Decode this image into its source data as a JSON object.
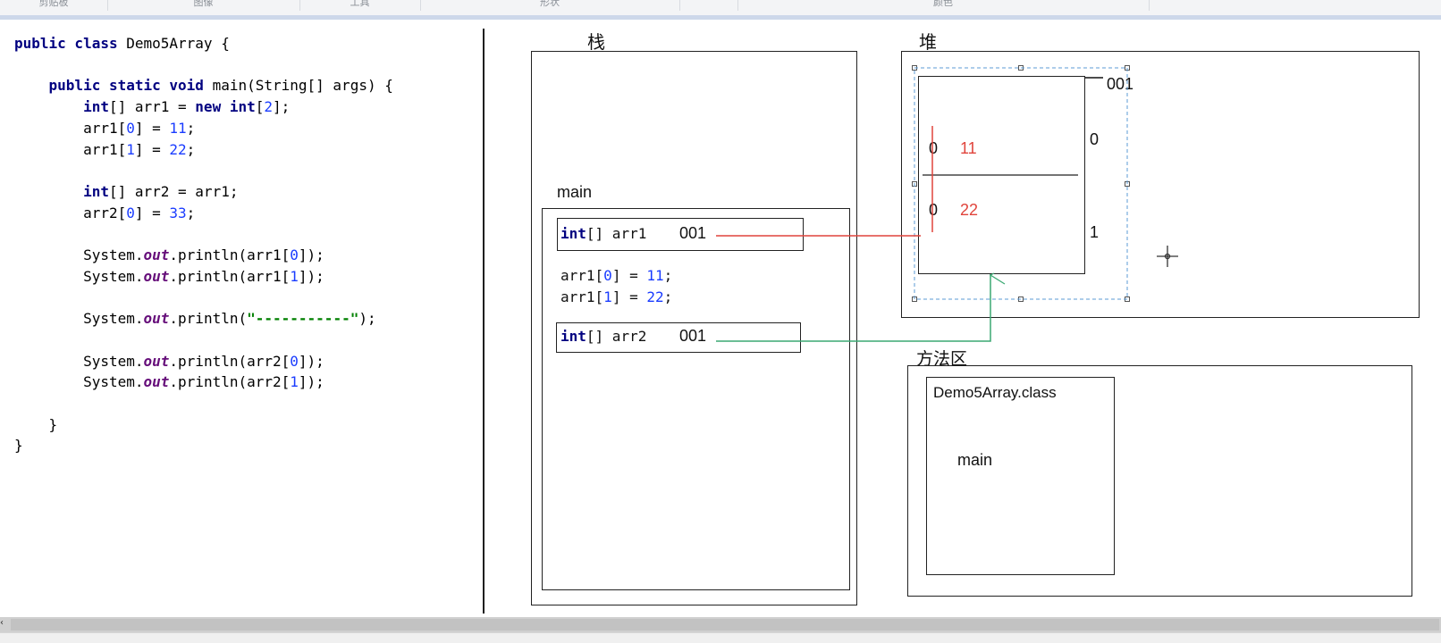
{
  "ribbon": {
    "groups": [
      "剪贴板",
      "图像",
      "工具",
      "形状",
      "颜色"
    ]
  },
  "code": {
    "lines": [
      [
        {
          "t": "public class ",
          "c": "kw"
        },
        {
          "t": "Demo5Array {",
          "c": ""
        }
      ],
      [],
      [
        {
          "t": "    public static void ",
          "c": "kw"
        },
        {
          "t": "main(String[] args) {",
          "c": ""
        }
      ],
      [
        {
          "t": "        int",
          "c": "kw"
        },
        {
          "t": "[] arr1 = ",
          "c": ""
        },
        {
          "t": "new int",
          "c": "kw"
        },
        {
          "t": "[",
          "c": ""
        },
        {
          "t": "2",
          "c": "num"
        },
        {
          "t": "];",
          "c": ""
        }
      ],
      [
        {
          "t": "        arr1[",
          "c": ""
        },
        {
          "t": "0",
          "c": "num"
        },
        {
          "t": "] = ",
          "c": ""
        },
        {
          "t": "11",
          "c": "num"
        },
        {
          "t": ";",
          "c": ""
        }
      ],
      [
        {
          "t": "        arr1[",
          "c": ""
        },
        {
          "t": "1",
          "c": "num"
        },
        {
          "t": "] = ",
          "c": ""
        },
        {
          "t": "22",
          "c": "num"
        },
        {
          "t": ";",
          "c": ""
        }
      ],
      [],
      [
        {
          "t": "        int",
          "c": "kw"
        },
        {
          "t": "[] arr2 = arr1;",
          "c": ""
        }
      ],
      [
        {
          "t": "        arr2[",
          "c": ""
        },
        {
          "t": "0",
          "c": "num"
        },
        {
          "t": "] = ",
          "c": ""
        },
        {
          "t": "33",
          "c": "num"
        },
        {
          "t": ";",
          "c": ""
        }
      ],
      [],
      [
        {
          "t": "        System.",
          "c": ""
        },
        {
          "t": "out",
          "c": "fld"
        },
        {
          "t": ".println(arr1[",
          "c": ""
        },
        {
          "t": "0",
          "c": "num"
        },
        {
          "t": "]);",
          "c": ""
        }
      ],
      [
        {
          "t": "        System.",
          "c": ""
        },
        {
          "t": "out",
          "c": "fld"
        },
        {
          "t": ".println(arr1[",
          "c": ""
        },
        {
          "t": "1",
          "c": "num"
        },
        {
          "t": "]);",
          "c": ""
        }
      ],
      [],
      [
        {
          "t": "        System.",
          "c": ""
        },
        {
          "t": "out",
          "c": "fld"
        },
        {
          "t": ".println(",
          "c": ""
        },
        {
          "t": "\"-----------\"",
          "c": "str"
        },
        {
          "t": ");",
          "c": ""
        }
      ],
      [],
      [
        {
          "t": "        System.",
          "c": ""
        },
        {
          "t": "out",
          "c": "fld"
        },
        {
          "t": ".println(arr2[",
          "c": ""
        },
        {
          "t": "0",
          "c": "num"
        },
        {
          "t": "]);",
          "c": ""
        }
      ],
      [
        {
          "t": "        System.",
          "c": ""
        },
        {
          "t": "out",
          "c": "fld"
        },
        {
          "t": ".println(arr2[",
          "c": ""
        },
        {
          "t": "1",
          "c": "num"
        },
        {
          "t": "]);",
          "c": ""
        }
      ],
      [],
      [
        {
          "t": "    }",
          "c": ""
        }
      ],
      [
        {
          "t": "}",
          "c": ""
        }
      ]
    ]
  },
  "diagram": {
    "stack_title": "栈",
    "heap_title": "堆",
    "method_area_title": "方法区",
    "frame_label": "main",
    "arr1_kw": "int",
    "arr1_decl": "[] arr1",
    "arr1_addr": "001",
    "assign_line1": {
      "pre": "arr1[",
      "idx": "0",
      "mid": "] = ",
      "val": "11",
      "end": ";"
    },
    "assign_line2": {
      "pre": "arr1[",
      "idx": "1",
      "mid": "] = ",
      "val": "22",
      "end": ";"
    },
    "arr2_kw": "int",
    "arr2_decl": "[] arr2",
    "arr2_addr": "001",
    "heap_addr": "001",
    "cell0_old": "0",
    "cell0_val": "11",
    "cell1_old": "0",
    "cell1_val": "22",
    "index0": "0",
    "index1": "1",
    "class_name": "Demo5Array.class",
    "method_name": "main"
  },
  "colors": {
    "arrow_arr1": "#e0443c",
    "arrow_arr2": "#3aa872",
    "selection": "#5b9bd5"
  },
  "icons": {
    "cursor": "crosshair-move-cursor-icon"
  }
}
